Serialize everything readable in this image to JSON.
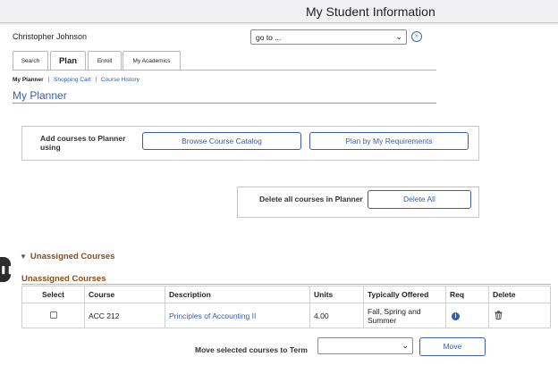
{
  "header": {
    "title": "My Student Information"
  },
  "student": {
    "name": "Christopher Johnson"
  },
  "goto": {
    "value": "go to ...",
    "go_icon": "arrow-circle-icon"
  },
  "tabs": [
    {
      "label": "Search",
      "active": false
    },
    {
      "label": "Plan",
      "active": true
    },
    {
      "label": "Enroll",
      "active": false
    },
    {
      "label": "My Academics",
      "active": false
    }
  ],
  "subnav": {
    "current": "My Planner",
    "links": [
      "Shopping Cart",
      "Course History"
    ],
    "separator": "|"
  },
  "page": {
    "title": "My Planner"
  },
  "add_courses": {
    "label": "Add courses to Planner using",
    "browse_button": "Browse Course Catalog",
    "requirements_button": "Plan by My Requirements"
  },
  "delete_all": {
    "label": "Delete all courses in Planner",
    "button": "Delete All"
  },
  "unassigned": {
    "section_title": "Unassigned Courses",
    "table_title": "Unassigned Courses",
    "columns": [
      "Select",
      "Course",
      "Description",
      "Units",
      "Typically Offered",
      "Req",
      "Delete"
    ],
    "rows": [
      {
        "selected": false,
        "course": "ACC 212",
        "description": "Principles of Accounting II",
        "units": "4.00",
        "offered": "Fall, Spring and Summer"
      }
    ]
  },
  "move": {
    "label": "Move selected courses to Term",
    "term_value": "",
    "button": "Move"
  },
  "colors": {
    "link": "#3a5ea8",
    "section": "#8a4e16",
    "border": "#c6c6c6"
  }
}
